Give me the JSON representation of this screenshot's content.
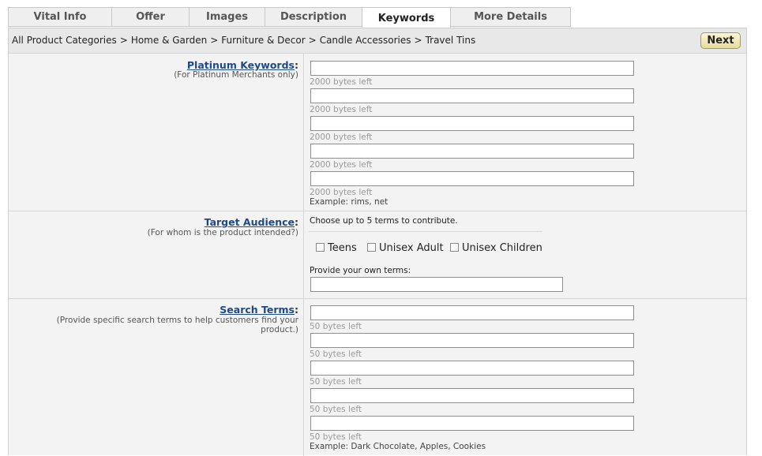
{
  "tabs": [
    "Vital Info",
    "Offer",
    "Images",
    "Description",
    "Keywords",
    "More Details"
  ],
  "breadcrumb": [
    "All Product Categories",
    "Home & Garden",
    "Furniture & Decor",
    "Candle Accessories",
    "Travel Tins"
  ],
  "breadcrumb_sep": ">",
  "next_label": "Next",
  "platinum": {
    "label": "Platinum Keywords",
    "help": "(For Platinum Merchants only)",
    "fields": [
      "",
      "",
      "",
      "",
      ""
    ],
    "bytes_left": "2000 bytes left",
    "example": "Example: rims, net"
  },
  "audience": {
    "label": "Target Audience",
    "help": "(For whom is the product intended?)",
    "instruction": "Choose up to 5 terms to contribute.",
    "options": [
      "Teens",
      "Unisex Adult",
      "Unisex Children"
    ],
    "own_terms_label": "Provide your own terms:",
    "own_terms_value": ""
  },
  "search": {
    "label": "Search Terms",
    "help": "(Provide specific search terms to help customers find your product.)",
    "fields": [
      "",
      "",
      "",
      "",
      ""
    ],
    "bytes_left": "50 bytes left",
    "example": "Example: Dark Chocolate, Apples, Cookies"
  },
  "colon": ":"
}
